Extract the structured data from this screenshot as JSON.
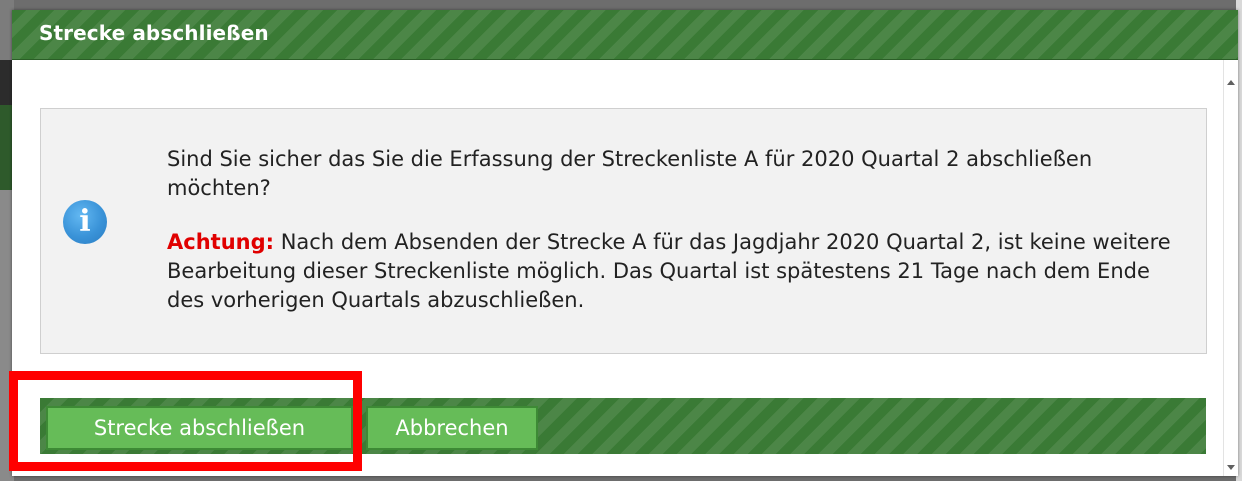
{
  "dialog": {
    "title": "Strecke abschließen",
    "message": {
      "icon": "info-icon",
      "icon_glyph": "i",
      "question": "Sind Sie sicher das Sie die Erfassung der Streckenliste A für 2020 Quartal 2 abschließen möchten?",
      "warning_label": "Achtung:",
      "warning_text": " Nach dem Absenden der Strecke A für das Jagdjahr 2020 Quartal 2, ist keine weitere Bearbeitung dieser Streckenliste möglich. Das Quartal ist spätestens 21 Tage nach dem Ende des vorherigen Quartals abzuschließen."
    },
    "buttons": {
      "confirm_label": "Strecke abschließen",
      "cancel_label": "Abbrechen"
    }
  },
  "colors": {
    "header_green": "#3a7a35",
    "button_green": "#66bc58",
    "warning_red": "#e00000",
    "info_blue": "#3a93d8",
    "highlight_red": "#ff0000"
  }
}
